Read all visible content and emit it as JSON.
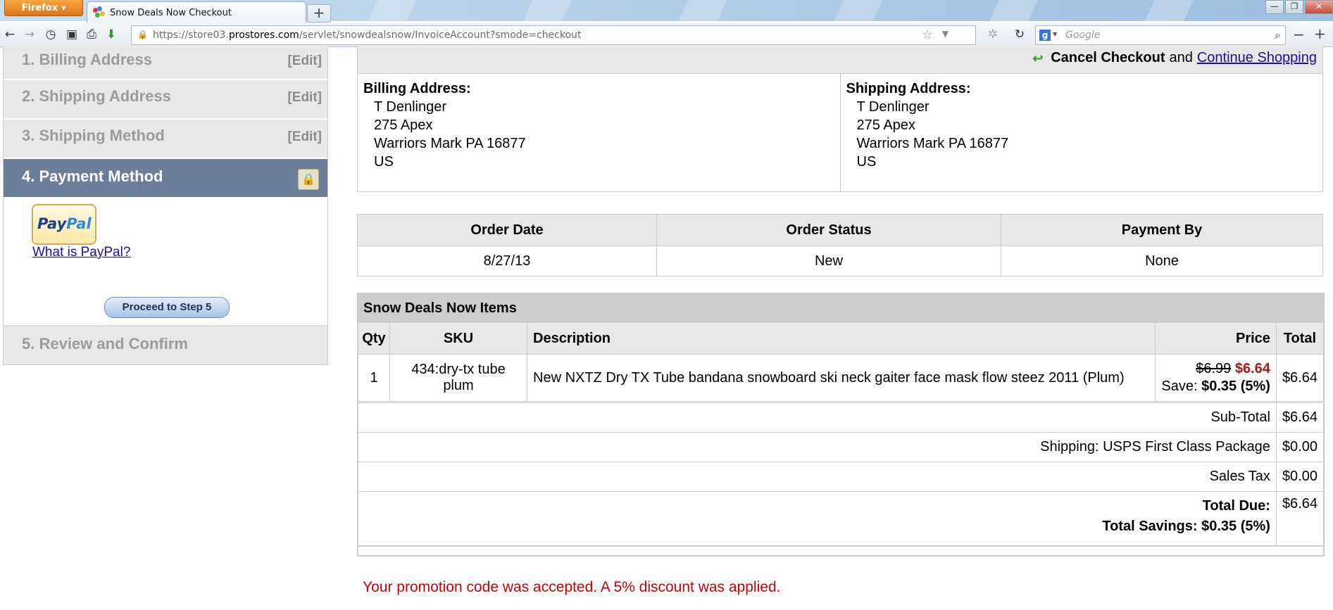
{
  "browser": {
    "menu_label": "Firefox",
    "tab_title": "Snow Deals Now Checkout",
    "url_prefix": "https://store03.",
    "url_domain": "prostores.com",
    "url_suffix": "/servlet/snowdealsnow/InvoiceAccount?smode=checkout",
    "search_placeholder": "Google"
  },
  "steps": {
    "billing": {
      "label": "1. Billing Address",
      "edit": "[Edit]"
    },
    "shipping_address": {
      "label": "2. Shipping Address",
      "edit": "[Edit]"
    },
    "shipping_method": {
      "label": "3. Shipping Method",
      "edit": "[Edit]"
    },
    "payment": {
      "label": "4. Payment Method"
    },
    "review": {
      "label": "5. Review and Confirm"
    }
  },
  "payment_panel": {
    "paypal_logo_text": "PayPal",
    "what_is_link": "What is PayPal?",
    "proceed_button": "Proceed to Step 5"
  },
  "cancel": {
    "cancel_label": "Cancel Checkout",
    "and": "and",
    "continue_label": "Continue Shopping"
  },
  "billing_address": {
    "title": "Billing Address:",
    "name": "T Denlinger",
    "street": "275 Apex",
    "city_line": "Warriors Mark PA 16877",
    "country": "US"
  },
  "shipping_address": {
    "title": "Shipping Address:",
    "name": "T Denlinger",
    "street": "275 Apex",
    "city_line": "Warriors Mark PA 16877",
    "country": "US"
  },
  "order_info": {
    "headers": [
      "Order Date",
      "Order Status",
      "Payment By"
    ],
    "values": [
      "8/27/13",
      "New",
      "None"
    ]
  },
  "items": {
    "section_title": "Snow Deals Now Items",
    "headers": [
      "Qty",
      "SKU",
      "Description",
      "Price",
      "Total"
    ],
    "rows": [
      {
        "qty": "1",
        "sku": "434:dry-tx tube plum",
        "description": "New NXTZ Dry TX Tube bandana snowboard ski neck gaiter face mask flow steez 2011 (Plum)",
        "old_price": "$6.99",
        "sale_price": "$6.64",
        "save_label": "Save:",
        "save_value": "$0.35 (5%)",
        "total": "$6.64"
      }
    ],
    "subtotal_label": "Sub-Total",
    "subtotal_value": "$6.64",
    "shipping_label": "Shipping: USPS First Class Package",
    "shipping_value": "$0.00",
    "tax_label": "Sales Tax",
    "tax_value": "$0.00",
    "total_due_label": "Total Due:",
    "total_due_value": "$6.64",
    "total_savings_label": "Total Savings: $0.35 (5%)"
  },
  "promo_message": "Your promotion code was accepted. A 5% discount was applied."
}
